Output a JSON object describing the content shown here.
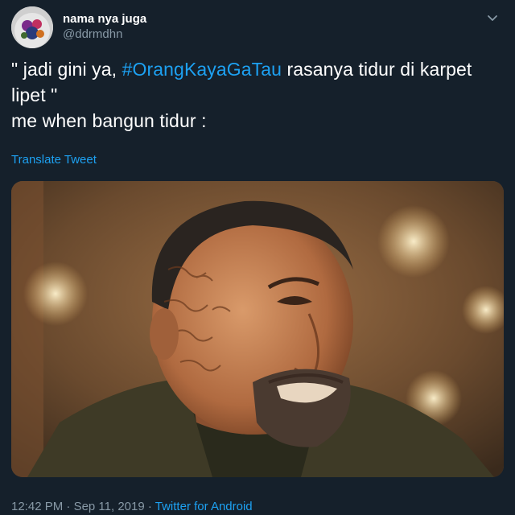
{
  "tweet": {
    "display_name": "nama nya juga",
    "handle": "@ddrmdhn",
    "text_before_hashtag": "\" jadi gini ya, ",
    "hashtag": "#OrangKayaGaTau",
    "text_after_hashtag": " rasanya tidur di karpet lipet \"",
    "text_line2": "me when bangun tidur :",
    "translate_label": "Translate Tweet",
    "time": "12:42 PM",
    "separator": " · ",
    "date": "Sep 11, 2019",
    "source": "Twitter for Android"
  },
  "icons": {
    "menu": "chevron-down-icon",
    "avatar": "avatar"
  },
  "colors": {
    "background": "#15202b",
    "text": "#ffffff",
    "secondary_text": "#8899a6",
    "accent": "#1da1f2"
  }
}
